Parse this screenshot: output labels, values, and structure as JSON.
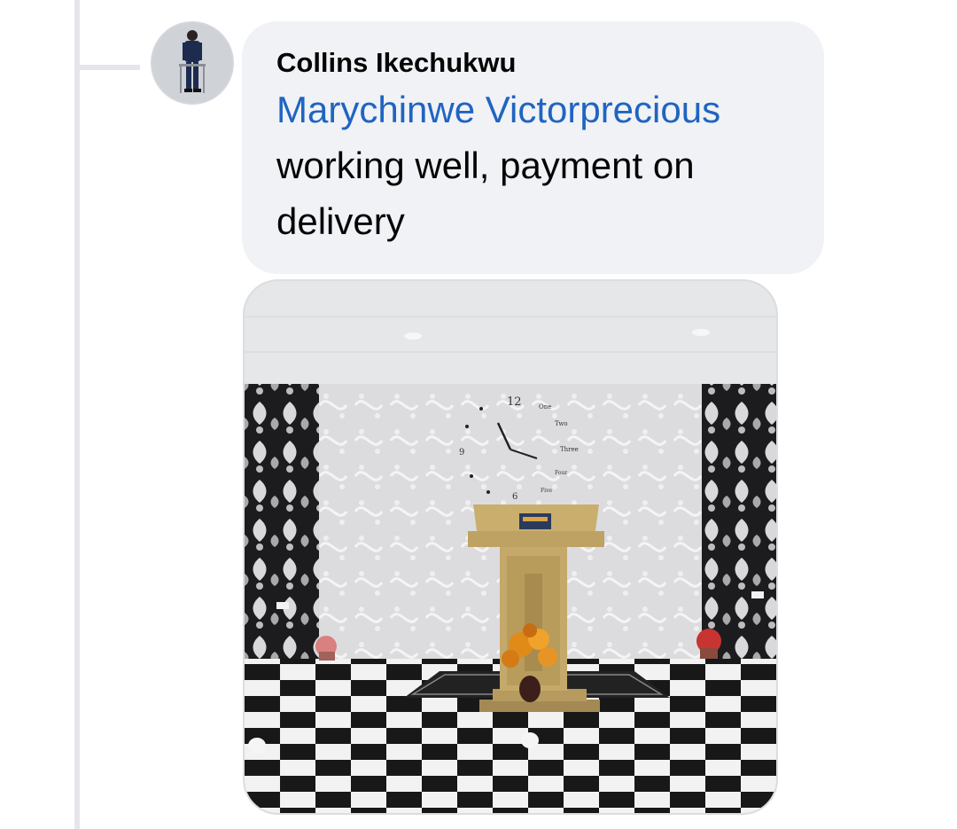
{
  "comment": {
    "author": "Collins Ikechukwu",
    "mention": "Marychinwe Victorprecious",
    "text": "working well, payment on delivery"
  },
  "attachment": {
    "clock_labels": [
      "12",
      "One",
      "Two",
      "Three",
      "Four",
      "Five",
      "6",
      "9"
    ]
  },
  "colors": {
    "bubble": "#f0f2f5",
    "mention": "#1f64c2",
    "thread_line": "#e4e6eb"
  }
}
